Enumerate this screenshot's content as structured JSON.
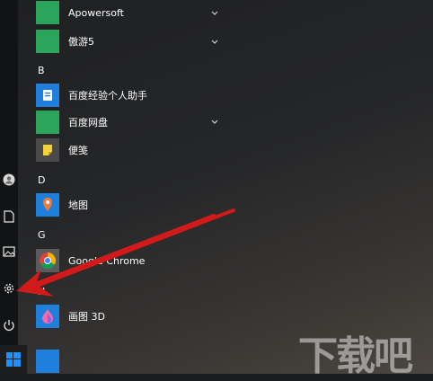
{
  "apps": [
    {
      "label": "Apowersoft",
      "icon": "folder-icon",
      "expandable": true
    },
    {
      "label": "傲游5",
      "icon": "folder-icon",
      "expandable": true
    }
  ],
  "sections": [
    {
      "header": "B",
      "items": [
        {
          "label": "百度经验个人助手",
          "icon": "baidu-assistant-icon",
          "expandable": false
        },
        {
          "label": "百度网盘",
          "icon": "folder-icon",
          "expandable": true
        },
        {
          "label": "便笺",
          "icon": "sticky-notes-icon",
          "expandable": false
        }
      ]
    },
    {
      "header": "D",
      "items": [
        {
          "label": "地图",
          "icon": "maps-icon",
          "expandable": false
        }
      ]
    },
    {
      "header": "G",
      "items": [
        {
          "label": "Google Chrome",
          "icon": "chrome-icon",
          "expandable": false
        }
      ]
    },
    {
      "header": "H",
      "items": [
        {
          "label": "画图 3D",
          "icon": "paint3d-icon",
          "expandable": false
        }
      ]
    }
  ],
  "rail": [
    "user-avatar-icon",
    "document-icon",
    "pictures-icon",
    "settings-icon",
    "power-icon"
  ],
  "colors": {
    "folder": "#2ba55b",
    "arrow": "#d21a1a",
    "start": "#1e90ff"
  },
  "watermark": "下载吧"
}
